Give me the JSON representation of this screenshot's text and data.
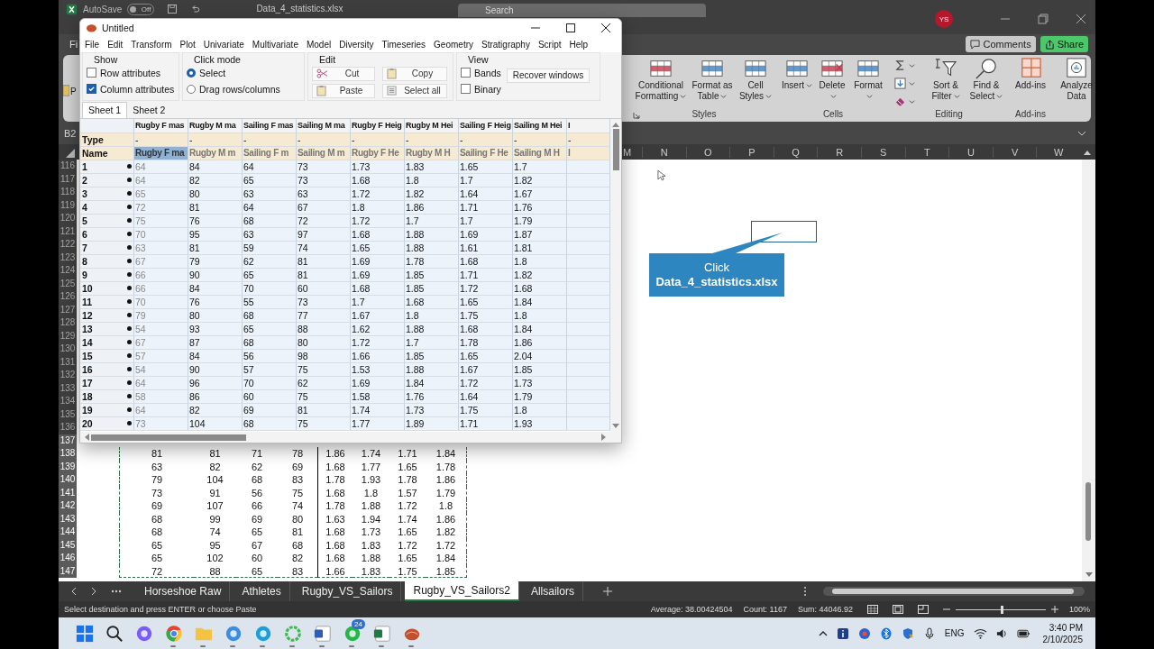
{
  "excel": {
    "title_bar": {
      "autosave": {
        "label": "AutoSave",
        "on": false,
        "state_text": "Off"
      },
      "file_name": "Data_4_statistics.xlsx",
      "search_placeholder": "Search",
      "user_initials": "YS"
    },
    "menu_fragment": "Fi",
    "comments": "Comments",
    "share": "Share",
    "ribbon_fragment": "P",
    "ribbon_groups": [
      {
        "label": "Styles",
        "launcher": true,
        "buttons": [
          {
            "kind": "conditional",
            "label": "Conditional Formatting",
            "dropdown": true
          },
          {
            "kind": "table",
            "label": "Format as Table",
            "dropdown": true
          },
          {
            "kind": "styles",
            "label": "Cell Styles",
            "dropdown": true
          }
        ]
      },
      {
        "label": "Cells",
        "buttons": [
          {
            "kind": "insert",
            "label": "Insert",
            "dropdown": true
          },
          {
            "kind": "delete",
            "label": "Delete",
            "dropdown": true
          },
          {
            "kind": "format",
            "label": "Format",
            "dropdown": true
          }
        ]
      },
      {
        "label": "Editing",
        "small_buttons": [
          {
            "kind": "sum",
            "dropdown": true
          },
          {
            "kind": "fill",
            "dropdown": true
          },
          {
            "kind": "clear",
            "dropdown": true
          }
        ],
        "buttons": [
          {
            "kind": "sort",
            "label": "Sort & Filter",
            "dropdown": true
          },
          {
            "kind": "find",
            "label": "Find & Select",
            "dropdown": true
          }
        ]
      },
      {
        "label": "Add-ins",
        "buttons": [
          {
            "kind": "addins",
            "label": "Add-ins",
            "dropdown": false
          }
        ]
      },
      {
        "buttons": [
          {
            "kind": "analyze",
            "label": "Analyze Data",
            "dropdown": false
          }
        ]
      }
    ],
    "name_box": "B2",
    "column_headers": [
      "M",
      "N",
      "O",
      "P",
      "Q",
      "R",
      "S",
      "T",
      "U",
      "V",
      "W"
    ],
    "rows": [
      {
        "number": "116",
        "selected": false
      },
      {
        "number": "117",
        "selected": false
      },
      {
        "number": "118",
        "selected": false
      },
      {
        "number": "119",
        "selected": false
      },
      {
        "number": "120",
        "selected": false
      },
      {
        "number": "121",
        "selected": false
      },
      {
        "number": "122",
        "selected": false
      },
      {
        "number": "123",
        "selected": false
      },
      {
        "number": "124",
        "selected": false
      },
      {
        "number": "125",
        "selected": false
      },
      {
        "number": "126",
        "selected": false
      },
      {
        "number": "127",
        "selected": false
      },
      {
        "number": "128",
        "selected": false
      },
      {
        "number": "129",
        "selected": false
      },
      {
        "number": "130",
        "selected": false
      },
      {
        "number": "131",
        "selected": false
      },
      {
        "number": "132",
        "selected": false
      },
      {
        "number": "133",
        "selected": false
      },
      {
        "number": "134",
        "selected": false
      },
      {
        "number": "135",
        "selected": false
      },
      {
        "number": "136",
        "selected": false
      },
      {
        "number": "137",
        "selected": true
      },
      {
        "number": "138",
        "selected": true,
        "cells": [
          "81",
          "81",
          "71",
          "78",
          "1.86",
          "1.74",
          "1.71",
          "1.84"
        ]
      },
      {
        "number": "139",
        "selected": true,
        "cells": [
          "63",
          "82",
          "62",
          "69",
          "1.68",
          "1.77",
          "1.65",
          "1.78"
        ]
      },
      {
        "number": "140",
        "selected": true,
        "cells": [
          "79",
          "104",
          "68",
          "83",
          "1.78",
          "1.93",
          "1.78",
          "1.86"
        ]
      },
      {
        "number": "141",
        "selected": true,
        "cells": [
          "73",
          "91",
          "56",
          "75",
          "1.68",
          "1.8",
          "1.57",
          "1.79"
        ]
      },
      {
        "number": "142",
        "selected": true,
        "cells": [
          "69",
          "107",
          "66",
          "74",
          "1.78",
          "1.88",
          "1.72",
          "1.8"
        ]
      },
      {
        "number": "143",
        "selected": true,
        "cells": [
          "68",
          "99",
          "69",
          "80",
          "1.63",
          "1.94",
          "1.74",
          "1.86"
        ]
      },
      {
        "number": "144",
        "selected": true,
        "cells": [
          "68",
          "74",
          "65",
          "81",
          "1.68",
          "1.73",
          "1.65",
          "1.82"
        ]
      },
      {
        "number": "145",
        "selected": true,
        "cells": [
          "65",
          "95",
          "67",
          "68",
          "1.68",
          "1.83",
          "1.72",
          "1.72"
        ]
      },
      {
        "number": "146",
        "selected": true,
        "cells": [
          "65",
          "102",
          "60",
          "82",
          "1.68",
          "1.88",
          "1.65",
          "1.84"
        ]
      },
      {
        "number": "147",
        "selected": true,
        "cells": [
          "72",
          "88",
          "65",
          "83",
          "1.66",
          "1.83",
          "1.75",
          "1.85"
        ]
      }
    ],
    "callout": {
      "text": "Click",
      "file": "Data_4_statistics.xlsx"
    },
    "sheet_tabs": [
      {
        "label": "Horseshoe Raw",
        "selected": false
      },
      {
        "label": "Athletes",
        "selected": false
      },
      {
        "label": "Rugby_VS_Sailors",
        "selected": false
      },
      {
        "label": "Rugby_VS_Sailors2",
        "selected": true
      },
      {
        "label": "Allsailors",
        "selected": false
      }
    ],
    "status_bar": {
      "message": "Select destination and press ENTER or choose Paste",
      "average": "Average: 38.00424504",
      "count": "Count: 1167",
      "sum": "Sum: 44046.92",
      "zoom_slider": {
        "level": 0.5
      },
      "zoom": "100%"
    }
  },
  "past_window": {
    "title": "Untitled",
    "menu": [
      "File",
      "Edit",
      "Transform",
      "Plot",
      "Univariate",
      "Multivariate",
      "Model",
      "Diversity",
      "Timeseries",
      "Geometry",
      "Stratigraphy",
      "Script",
      "Help"
    ],
    "show": {
      "label": "Show",
      "options": [
        {
          "label": "Row attributes",
          "checked": false
        },
        {
          "label": "Column attributes",
          "checked": true
        }
      ]
    },
    "click_mode": {
      "label": "Click mode",
      "options": [
        {
          "label": "Select",
          "selected": true
        },
        {
          "label": "Drag rows/columns",
          "selected": false
        }
      ]
    },
    "edit": {
      "label": "Edit",
      "buttons": [
        {
          "kind": "cut",
          "label": "Cut"
        },
        {
          "kind": "copy",
          "label": "Copy"
        },
        {
          "kind": "paste",
          "label": "Paste"
        },
        {
          "kind": "select-all",
          "label": "Select all"
        }
      ]
    },
    "view": {
      "label": "View",
      "options": [
        {
          "label": "Bands",
          "checked": false
        },
        {
          "label": "Binary",
          "checked": false
        }
      ],
      "button": "Recover windows"
    },
    "sheet_tabs": [
      {
        "label": "Sheet 1",
        "selected": true
      },
      {
        "label": "Sheet 2",
        "selected": false
      }
    ],
    "table": {
      "type_label": "Type",
      "name_label": "Name",
      "columns": [
        {
          "header": "Rugby F mas",
          "type": "-",
          "name": "Rugby F ma",
          "selected": true
        },
        {
          "header": "Rugby M ma",
          "type": "-",
          "name": "Rugby M m",
          "selected": false
        },
        {
          "header": "Sailing F mas",
          "type": "-",
          "name": "Sailing F m",
          "selected": false
        },
        {
          "header": "Sailing M ma",
          "type": "-",
          "name": "Sailing M m",
          "selected": false
        },
        {
          "header": "Rugby F Heig",
          "type": "-",
          "name": "Rugby F He",
          "selected": false
        },
        {
          "header": "Rugby M Hei",
          "type": "-",
          "name": "Rugby M H",
          "selected": false
        },
        {
          "header": "Sailing F Heig",
          "type": "-",
          "name": "Sailing F He",
          "selected": false
        },
        {
          "header": "Sailing M Hei",
          "type": "-",
          "name": "Sailing M H",
          "selected": false
        },
        {
          "header": "I",
          "type": "-",
          "name": "I",
          "selected": false
        }
      ],
      "rows": [
        {
          "label": "1",
          "cells": [
            "64",
            "84",
            "64",
            "73",
            "1.73",
            "1.83",
            "1.65",
            "1.7"
          ]
        },
        {
          "label": "2",
          "cells": [
            "64",
            "82",
            "65",
            "73",
            "1.68",
            "1.8",
            "1.7",
            "1.82"
          ]
        },
        {
          "label": "3",
          "cells": [
            "65",
            "80",
            "63",
            "63",
            "1.72",
            "1.82",
            "1.64",
            "1.67"
          ]
        },
        {
          "label": "4",
          "cells": [
            "72",
            "81",
            "64",
            "67",
            "1.8",
            "1.86",
            "1.71",
            "1.76"
          ]
        },
        {
          "label": "5",
          "cells": [
            "75",
            "76",
            "68",
            "72",
            "1.72",
            "1.7",
            "1.7",
            "1.79"
          ]
        },
        {
          "label": "6",
          "cells": [
            "70",
            "95",
            "63",
            "97",
            "1.68",
            "1.88",
            "1.69",
            "1.87"
          ]
        },
        {
          "label": "7",
          "cells": [
            "63",
            "81",
            "59",
            "74",
            "1.65",
            "1.88",
            "1.61",
            "1.81"
          ]
        },
        {
          "label": "8",
          "cells": [
            "67",
            "79",
            "62",
            "81",
            "1.69",
            "1.78",
            "1.68",
            "1.8"
          ]
        },
        {
          "label": "9",
          "cells": [
            "66",
            "90",
            "65",
            "81",
            "1.69",
            "1.85",
            "1.71",
            "1.82"
          ]
        },
        {
          "label": "10",
          "cells": [
            "66",
            "84",
            "70",
            "60",
            "1.68",
            "1.85",
            "1.72",
            "1.68"
          ]
        },
        {
          "label": "11",
          "cells": [
            "70",
            "76",
            "55",
            "73",
            "1.7",
            "1.68",
            "1.65",
            "1.84"
          ]
        },
        {
          "label": "12",
          "cells": [
            "79",
            "80",
            "68",
            "77",
            "1.67",
            "1.8",
            "1.75",
            "1.8"
          ]
        },
        {
          "label": "13",
          "cells": [
            "54",
            "93",
            "65",
            "88",
            "1.62",
            "1.88",
            "1.68",
            "1.84"
          ]
        },
        {
          "label": "14",
          "cells": [
            "67",
            "87",
            "68",
            "80",
            "1.72",
            "1.7",
            "1.78",
            "1.86"
          ]
        },
        {
          "label": "15",
          "cells": [
            "57",
            "84",
            "56",
            "98",
            "1.66",
            "1.85",
            "1.65",
            "2.04"
          ]
        },
        {
          "label": "16",
          "cells": [
            "54",
            "90",
            "57",
            "75",
            "1.53",
            "1.88",
            "1.67",
            "1.85"
          ]
        },
        {
          "label": "17",
          "cells": [
            "64",
            "96",
            "70",
            "62",
            "1.69",
            "1.84",
            "1.72",
            "1.73"
          ]
        },
        {
          "label": "18",
          "cells": [
            "58",
            "86",
            "60",
            "75",
            "1.58",
            "1.76",
            "1.64",
            "1.79"
          ]
        },
        {
          "label": "19",
          "cells": [
            "64",
            "82",
            "69",
            "81",
            "1.74",
            "1.73",
            "1.75",
            "1.8"
          ]
        },
        {
          "label": "20",
          "cells": [
            "73",
            "104",
            "68",
            "75",
            "1.77",
            "1.89",
            "1.71",
            "1.93"
          ]
        }
      ]
    }
  },
  "taskbar": {
    "apps": [
      {
        "kind": "start",
        "running": false
      },
      {
        "kind": "search",
        "running": false
      },
      {
        "kind": "copilot",
        "running": false
      },
      {
        "kind": "chrome",
        "running": true
      },
      {
        "kind": "files",
        "running": true
      },
      {
        "kind": "photos",
        "running": true
      },
      {
        "kind": "edge",
        "running": true
      },
      {
        "kind": "ring",
        "running": true
      },
      {
        "kind": "word",
        "running": true
      },
      {
        "kind": "whatsapp",
        "running": true,
        "badge": "24"
      },
      {
        "kind": "excel",
        "running": true
      },
      {
        "kind": "past",
        "running": true
      }
    ],
    "language": "ENG",
    "time": "3:40 PM",
    "date": "2/10/2025"
  }
}
